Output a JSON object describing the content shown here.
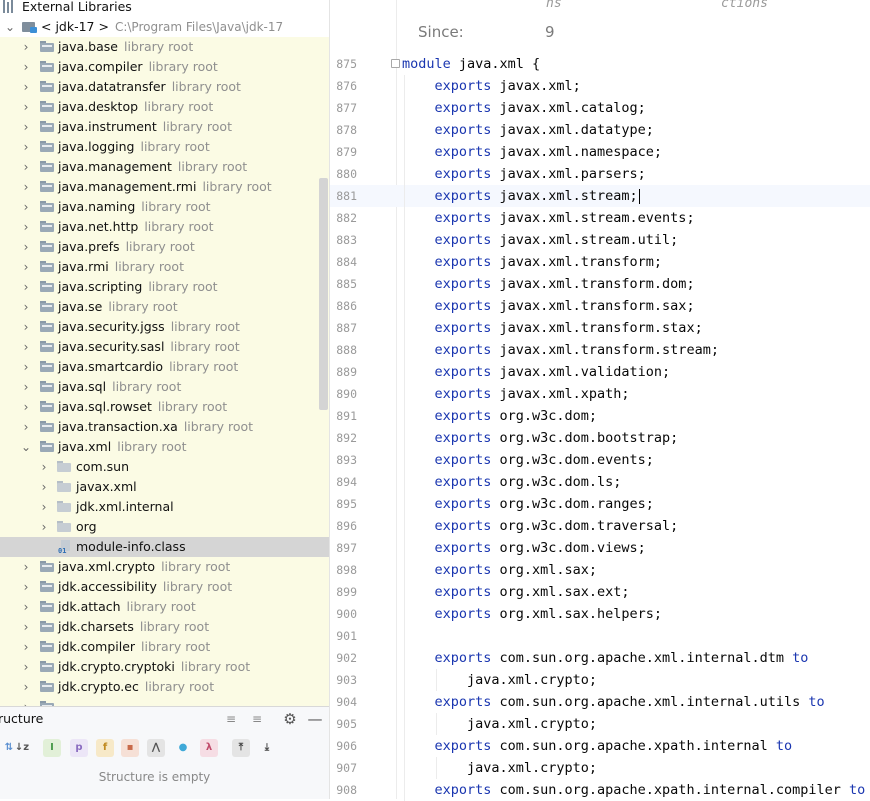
{
  "project_tree": {
    "root": "External Libraries",
    "jdk": {
      "label": "< jdk-17 >",
      "path": "C:\\Program Files\\Java\\jdk-17"
    },
    "modules_before": [
      {
        "name": "java.base",
        "suffix": "library root"
      },
      {
        "name": "java.compiler",
        "suffix": "library root"
      },
      {
        "name": "java.datatransfer",
        "suffix": "library root"
      },
      {
        "name": "java.desktop",
        "suffix": "library root"
      },
      {
        "name": "java.instrument",
        "suffix": "library root"
      },
      {
        "name": "java.logging",
        "suffix": "library root"
      },
      {
        "name": "java.management",
        "suffix": "library root"
      },
      {
        "name": "java.management.rmi",
        "suffix": "library root"
      },
      {
        "name": "java.naming",
        "suffix": "library root"
      },
      {
        "name": "java.net.http",
        "suffix": "library root"
      },
      {
        "name": "java.prefs",
        "suffix": "library root"
      },
      {
        "name": "java.rmi",
        "suffix": "library root"
      },
      {
        "name": "java.scripting",
        "suffix": "library root"
      },
      {
        "name": "java.se",
        "suffix": "library root"
      },
      {
        "name": "java.security.jgss",
        "suffix": "library root"
      },
      {
        "name": "java.security.sasl",
        "suffix": "library root"
      },
      {
        "name": "java.smartcardio",
        "suffix": "library root"
      },
      {
        "name": "java.sql",
        "suffix": "library root"
      },
      {
        "name": "java.sql.rowset",
        "suffix": "library root"
      },
      {
        "name": "java.transaction.xa",
        "suffix": "library root"
      }
    ],
    "expanded_module": {
      "name": "java.xml",
      "suffix": "library root"
    },
    "packages": [
      "com.sun",
      "javax.xml",
      "jdk.xml.internal",
      "org"
    ],
    "selected_file": "module-info.class",
    "modules_after": [
      {
        "name": "java.xml.crypto",
        "suffix": "library root"
      },
      {
        "name": "jdk.accessibility",
        "suffix": "library root"
      },
      {
        "name": "jdk.attach",
        "suffix": "library root"
      },
      {
        "name": "jdk.charsets",
        "suffix": "library root"
      },
      {
        "name": "jdk.compiler",
        "suffix": "library root"
      },
      {
        "name": "jdk.crypto.cryptoki",
        "suffix": "library root"
      },
      {
        "name": "jdk.crypto.ec",
        "suffix": "library root"
      }
    ]
  },
  "structure": {
    "title": "ructure",
    "empty_text": "Structure is empty",
    "toolbar": [
      {
        "icon": "sort-visibility-icon",
        "glyph": "⇅",
        "color": "#5a8fd0",
        "bg": "transparent"
      },
      {
        "icon": "sort-alpha-icon",
        "glyph": "↓z",
        "color": "#555555",
        "bg": "transparent"
      },
      {
        "icon": "show-inherited-icon",
        "glyph": "I",
        "color": "#4a9a4a",
        "bg": "#e2f0d8"
      },
      {
        "icon": "show-properties-icon",
        "glyph": "p",
        "color": "#8a6cc0",
        "bg": "#ece6f7"
      },
      {
        "icon": "show-fields-icon",
        "glyph": "f",
        "color": "#c08a20",
        "bg": "#f7e9c8"
      },
      {
        "icon": "show-non-public-icon",
        "glyph": "▪",
        "color": "#c86a4a",
        "bg": "#f6e0d6"
      },
      {
        "icon": "show-lambdas-icon",
        "glyph": "⋀",
        "color": "#555555",
        "bg": "#e4e4e4"
      },
      {
        "icon": "show-anonymous-icon",
        "glyph": "●",
        "color": "#3fa9d8",
        "bg": "transparent"
      },
      {
        "icon": "show-lambda-icon",
        "glyph": "λ",
        "color": "#c04a6a",
        "bg": "#f6dde4"
      },
      {
        "icon": "autoscroll-to-source-icon",
        "glyph": "⤒",
        "color": "#444444",
        "bg": "#e4e4e4"
      },
      {
        "icon": "autoscroll-from-source-icon",
        "glyph": "⤓",
        "color": "#444444",
        "bg": "transparent"
      }
    ]
  },
  "editor": {
    "doc_popup": {
      "since_label": "Since:",
      "since_value": "9",
      "fragments": [
        "ns",
        "ctions"
      ]
    },
    "lines": [
      {
        "n": "875",
        "indent": 0,
        "kw": "module",
        "text": " java.xml {"
      },
      {
        "n": "876",
        "indent": 1,
        "kw": "exports",
        "text": " javax.xml;"
      },
      {
        "n": "877",
        "indent": 1,
        "kw": "exports",
        "text": " javax.xml.catalog;"
      },
      {
        "n": "878",
        "indent": 1,
        "kw": "exports",
        "text": " javax.xml.datatype;"
      },
      {
        "n": "879",
        "indent": 1,
        "kw": "exports",
        "text": " javax.xml.namespace;"
      },
      {
        "n": "880",
        "indent": 1,
        "kw": "exports",
        "text": " javax.xml.parsers;"
      },
      {
        "n": "881",
        "indent": 1,
        "kw": "exports",
        "text": " javax.xml.stream;",
        "caret": true
      },
      {
        "n": "882",
        "indent": 1,
        "kw": "exports",
        "text": " javax.xml.stream.events;"
      },
      {
        "n": "883",
        "indent": 1,
        "kw": "exports",
        "text": " javax.xml.stream.util;"
      },
      {
        "n": "884",
        "indent": 1,
        "kw": "exports",
        "text": " javax.xml.transform;"
      },
      {
        "n": "885",
        "indent": 1,
        "kw": "exports",
        "text": " javax.xml.transform.dom;"
      },
      {
        "n": "886",
        "indent": 1,
        "kw": "exports",
        "text": " javax.xml.transform.sax;"
      },
      {
        "n": "887",
        "indent": 1,
        "kw": "exports",
        "text": " javax.xml.transform.stax;"
      },
      {
        "n": "888",
        "indent": 1,
        "kw": "exports",
        "text": " javax.xml.transform.stream;"
      },
      {
        "n": "889",
        "indent": 1,
        "kw": "exports",
        "text": " javax.xml.validation;"
      },
      {
        "n": "890",
        "indent": 1,
        "kw": "exports",
        "text": " javax.xml.xpath;"
      },
      {
        "n": "891",
        "indent": 1,
        "kw": "exports",
        "text": " org.w3c.dom;"
      },
      {
        "n": "892",
        "indent": 1,
        "kw": "exports",
        "text": " org.w3c.dom.bootstrap;"
      },
      {
        "n": "893",
        "indent": 1,
        "kw": "exports",
        "text": " org.w3c.dom.events;"
      },
      {
        "n": "894",
        "indent": 1,
        "kw": "exports",
        "text": " org.w3c.dom.ls;"
      },
      {
        "n": "895",
        "indent": 1,
        "kw": "exports",
        "text": " org.w3c.dom.ranges;"
      },
      {
        "n": "896",
        "indent": 1,
        "kw": "exports",
        "text": " org.w3c.dom.traversal;"
      },
      {
        "n": "897",
        "indent": 1,
        "kw": "exports",
        "text": " org.w3c.dom.views;"
      },
      {
        "n": "898",
        "indent": 1,
        "kw": "exports",
        "text": " org.xml.sax;"
      },
      {
        "n": "899",
        "indent": 1,
        "kw": "exports",
        "text": " org.xml.sax.ext;"
      },
      {
        "n": "900",
        "indent": 1,
        "kw": "exports",
        "text": " org.xml.sax.helpers;"
      },
      {
        "n": "901",
        "indent": 1,
        "kw": "",
        "text": ""
      },
      {
        "n": "902",
        "indent": 1,
        "kw": "exports",
        "text": " com.sun.org.apache.xml.internal.dtm ",
        "kw2": "to"
      },
      {
        "n": "903",
        "indent": 2,
        "kw": "",
        "text": "java.xml.crypto;"
      },
      {
        "n": "904",
        "indent": 1,
        "kw": "exports",
        "text": " com.sun.org.apache.xml.internal.utils ",
        "kw2": "to"
      },
      {
        "n": "905",
        "indent": 2,
        "kw": "",
        "text": "java.xml.crypto;"
      },
      {
        "n": "906",
        "indent": 1,
        "kw": "exports",
        "text": " com.sun.org.apache.xpath.internal ",
        "kw2": "to"
      },
      {
        "n": "907",
        "indent": 2,
        "kw": "",
        "text": "java.xml.crypto;"
      },
      {
        "n": "908",
        "indent": 1,
        "kw": "exports",
        "text": " com.sun.org.apache.xpath.internal.compiler ",
        "kw2": "to"
      }
    ]
  }
}
